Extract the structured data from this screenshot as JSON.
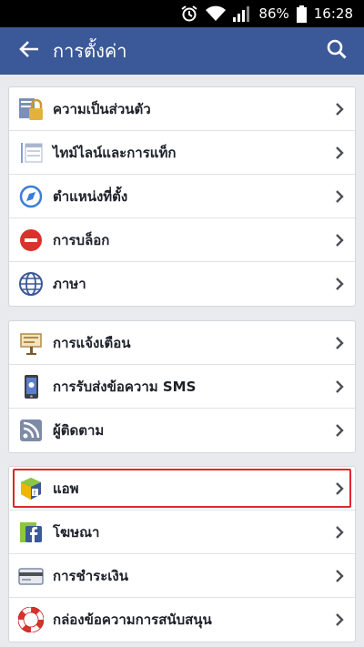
{
  "status_bar": {
    "battery": "86%",
    "time": "16:28"
  },
  "header": {
    "title": "การตั้งค่า"
  },
  "groups": [
    {
      "items": [
        {
          "label": "ความเป็นส่วนตัว",
          "icon": "privacy-lock-icon"
        },
        {
          "label": "ไทม์ไลน์และการแท็ก",
          "icon": "timeline-icon"
        },
        {
          "label": "ตำแหน่งที่ตั้ง",
          "icon": "location-compass-icon"
        },
        {
          "label": "การบล็อก",
          "icon": "block-icon"
        },
        {
          "label": "ภาษา",
          "icon": "globe-icon"
        }
      ]
    },
    {
      "items": [
        {
          "label": "การแจ้งเตือน",
          "icon": "notification-sign-icon"
        },
        {
          "label": "การรับส่งข้อความ SMS",
          "icon": "phone-sms-icon"
        },
        {
          "label": "ผู้ติดตาม",
          "icon": "rss-icon"
        }
      ]
    },
    {
      "items": [
        {
          "label": "แอพ",
          "icon": "apps-cube-icon",
          "highlighted": true
        },
        {
          "label": "โฆษณา",
          "icon": "ads-facebook-icon"
        },
        {
          "label": "การชำระเงิน",
          "icon": "credit-card-icon"
        },
        {
          "label": "กล่องข้อความการสนับสนุน",
          "icon": "lifebuoy-icon"
        }
      ]
    }
  ],
  "colors": {
    "brand": "#3b5998",
    "highlight": "#e0242c",
    "background": "#e9eaee"
  }
}
